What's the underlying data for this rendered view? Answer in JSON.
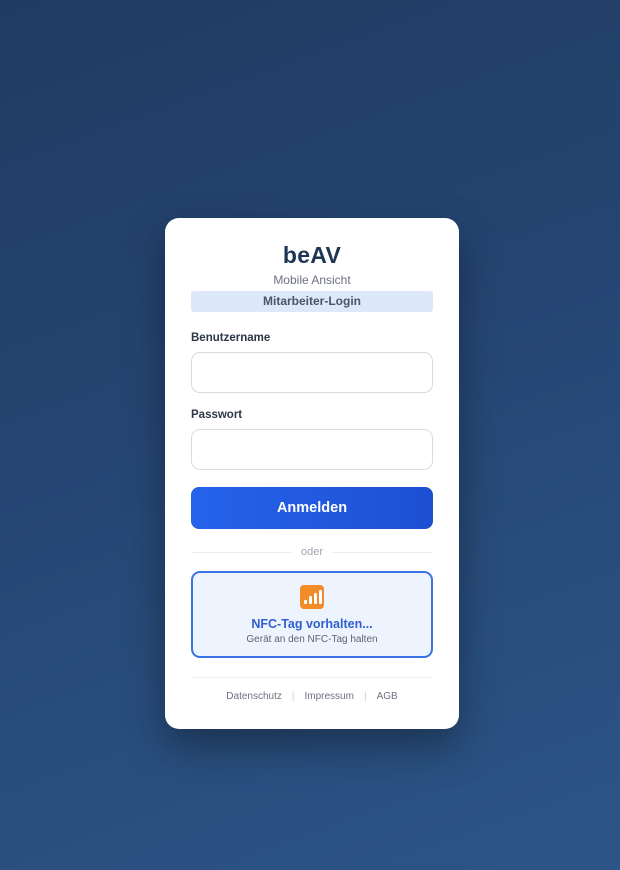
{
  "app": {
    "title": "beAV",
    "subtitle": "Mobile Ansicht",
    "mode_badge": "Mitarbeiter-Login"
  },
  "form": {
    "username_label": "Benutzername",
    "username_value": "",
    "password_label": "Passwort",
    "password_value": "",
    "submit_label": "Anmelden"
  },
  "divider": {
    "text": "oder"
  },
  "nfc": {
    "icon": "signal-bars-icon",
    "title": "NFC-Tag vorhalten...",
    "subtitle": "Gerät an den NFC-Tag halten"
  },
  "footer": {
    "links": [
      "Datenschutz",
      "Impressum",
      "AGB"
    ],
    "separator": "|"
  },
  "colors": {
    "primary": "#2563eb",
    "nfc_accent": "#3b73e6",
    "nfc_icon": "#f28c28",
    "badge_bg": "#dde8fb"
  }
}
